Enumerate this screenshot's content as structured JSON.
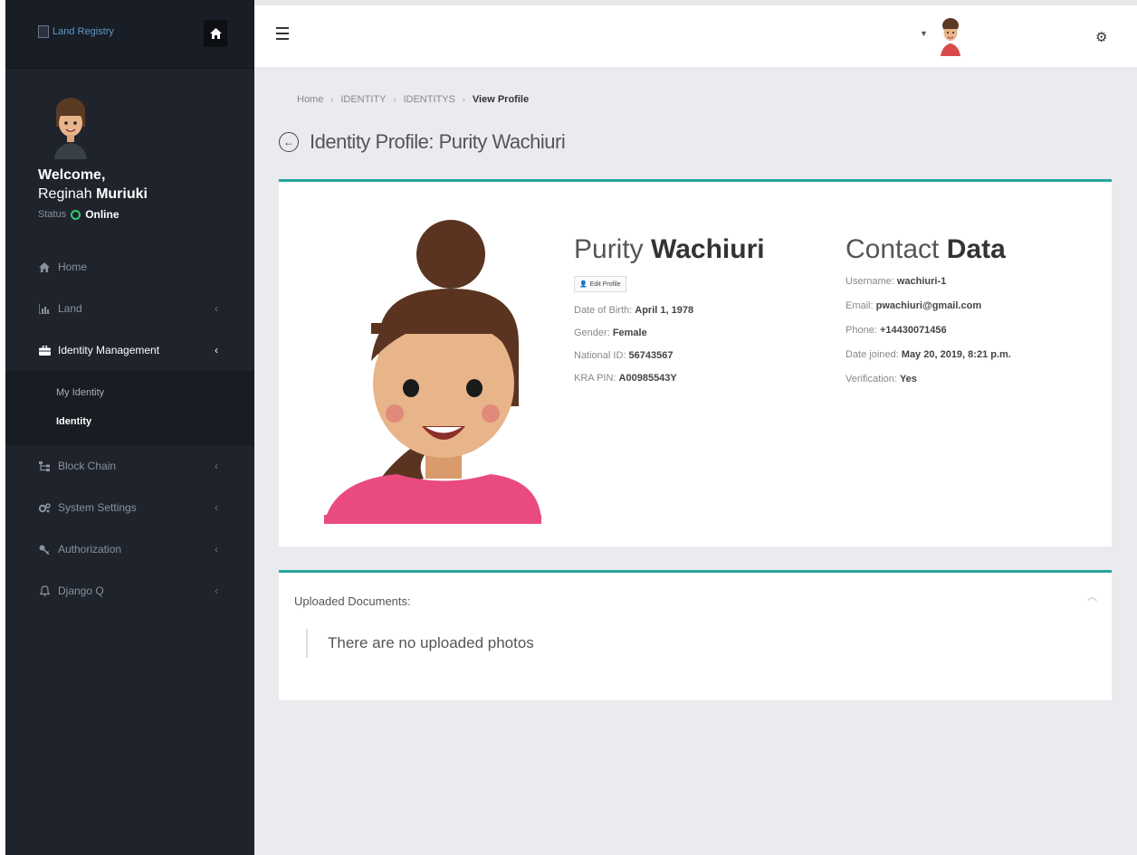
{
  "sidebar": {
    "brand_alt": "Land Registry",
    "welcome": "Welcome,",
    "user_first": "Reginah",
    "user_last": "Muriuki",
    "status_label": "Status",
    "status_value": "Online",
    "menu": [
      {
        "label": "Home",
        "icon": "home-icon"
      },
      {
        "label": "Land",
        "icon": "chart-icon"
      },
      {
        "label": "Identity Management",
        "icon": "briefcase-icon"
      },
      {
        "label": "Block Chain",
        "icon": "sitemap-icon"
      },
      {
        "label": "System Settings",
        "icon": "gears-icon"
      },
      {
        "label": "Authorization",
        "icon": "key-icon"
      },
      {
        "label": "Django Q",
        "icon": "bell-icon"
      }
    ],
    "submenu": [
      {
        "label": "My Identity"
      },
      {
        "label": "Identity"
      }
    ]
  },
  "breadcrumb": [
    "Home",
    "IDENTITY",
    "IDENTITYS",
    "View Profile"
  ],
  "page_title": "Identity Profile: Purity Wachiuri",
  "profile": {
    "first_name": "Purity",
    "last_name": "Wachiuri",
    "edit_label": "Edit Profile",
    "dob_label": "Date of Birth:",
    "dob": "April 1, 1978",
    "gender_label": "Gender:",
    "gender": "Female",
    "national_id_label": "National ID:",
    "national_id": "56743567",
    "kra_label": "KRA PIN:",
    "kra": "A00985543Y"
  },
  "contact": {
    "heading_light": "Contact",
    "heading_bold": "Data",
    "username_label": "Username:",
    "username": "wachiuri-1",
    "email_label": "Email:",
    "email": "pwachiuri@gmail.com",
    "phone_label": "Phone:",
    "phone": "+14430071456",
    "joined_label": "Date joined:",
    "joined": "May 20, 2019, 8:21 p.m.",
    "verification_label": "Verification:",
    "verification": "Yes"
  },
  "documents": {
    "header": "Uploaded Documents:",
    "empty": "There are no uploaded photos"
  },
  "colors": {
    "accent": "#26a69a",
    "sidebar": "#1e232c",
    "online": "#2ecc71"
  }
}
